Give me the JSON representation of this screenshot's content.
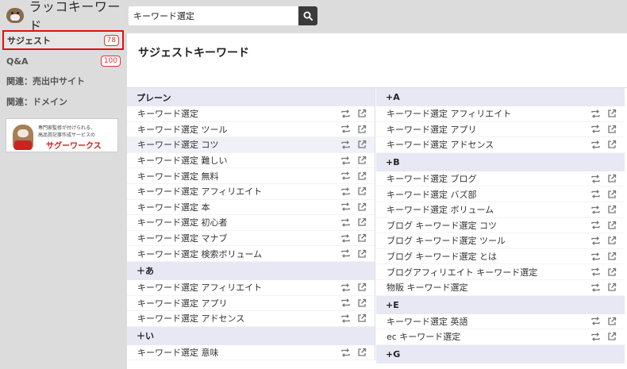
{
  "app": {
    "name": "ラッコキーワード"
  },
  "search": {
    "value": "キーワード選定"
  },
  "sidebar": {
    "items": [
      {
        "label": "サジェスト",
        "count": "78"
      },
      {
        "label": "Q&A",
        "count": "100"
      },
      {
        "label": "関連：売出中サイト"
      },
      {
        "label": "関連：ドメイン"
      }
    ],
    "banner": {
      "line1": "専門家監修が付けられる、",
      "line2": "高品質記事作成サービスの",
      "brand": "サグーワークス"
    }
  },
  "main": {
    "title": "サジェストキーワード",
    "left_groups": [
      {
        "heading": "プレーン",
        "items": [
          "キーワード選定",
          "キーワード選定 ツール",
          "キーワード選定 コツ",
          "キーワード選定 難しい",
          "キーワード選定 無料",
          "キーワード選定 アフィリエイト",
          "キーワード選定 本",
          "キーワード選定 初心者",
          "キーワード選定 マナブ",
          "キーワード選定 検索ボリューム"
        ]
      },
      {
        "heading": "＋あ",
        "items": [
          "キーワード選定 アフィリエイト",
          "キーワード選定 アプリ",
          "キーワード選定 アドセンス"
        ]
      },
      {
        "heading": "＋い",
        "items": [
          "キーワード選定 意味"
        ]
      }
    ],
    "right_groups": [
      {
        "heading": "+A",
        "items": [
          "キーワード選定 アフィリエイト",
          "キーワード選定 アプリ",
          "キーワード選定 アドセンス"
        ]
      },
      {
        "heading": "+B",
        "items": [
          "キーワード選定 ブログ",
          "キーワード選定 バズ部",
          "キーワード選定 ボリューム",
          "ブログ キーワード選定 コツ",
          "ブログ キーワード選定 ツール",
          "ブログ キーワード選定 とは",
          "ブログアフィリエイト キーワード選定",
          "物販 キーワード選定"
        ]
      },
      {
        "heading": "+E",
        "items": [
          "キーワード選定 英語",
          "ec キーワード選定"
        ]
      },
      {
        "heading": "+G",
        "items": []
      }
    ]
  },
  "icons": {
    "row_actions": [
      "retweet-icon",
      "external-link-icon"
    ],
    "search_button": "search-icon"
  },
  "colors": {
    "active_border": "#e01010",
    "badge": "#dd3333",
    "group_header_bg": "#e6e9f4",
    "sidebar_bg": "#dcdcdc"
  }
}
